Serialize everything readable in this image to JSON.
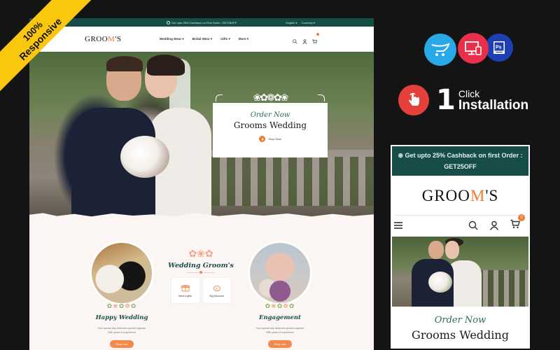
{
  "ribbon": {
    "line1": "100%",
    "line2": "Responsive"
  },
  "desktop": {
    "topbar": {
      "promo": "Get upto 25% Cashback on First Order : GET25OFF",
      "language": "English",
      "currency": "Currency"
    },
    "logo": {
      "prefix": "GROO",
      "accent": "M",
      "suffix": "'S"
    },
    "menu": [
      {
        "label": "Wedding Wear"
      },
      {
        "label": "Bridal Wear"
      },
      {
        "label": "Gifts"
      },
      {
        "label": "More"
      }
    ],
    "icons": [
      "search-icon",
      "user-icon",
      "cart-icon"
    ],
    "hero": {
      "script": "Order Now",
      "title": "Grooms Wedding",
      "button": "Shop Now"
    },
    "section": {
      "title": "Wedding Groom's",
      "features": [
        {
          "label": "Send a gifts",
          "icon": "gift-icon"
        },
        {
          "label": "Big Discount",
          "icon": "piggy-bank-icon"
        }
      ],
      "items": [
        {
          "title": "Happy Wedding",
          "desc1": "Your special day deserves special organize",
          "desc2": "With years of experience",
          "button": "Shop now"
        },
        {
          "title": "Engagement",
          "desc1": "Your special day deserves special organize",
          "desc2": "With years of experience",
          "button": "Shop now"
        }
      ]
    }
  },
  "platforms": [
    "opencart-icon",
    "responsive-devices-icon",
    "photoshop-icon"
  ],
  "platform_text": {
    "ps": "Ps"
  },
  "install": {
    "number": "1",
    "line1": "Click",
    "line2": "Installation"
  },
  "mobile": {
    "promo": "Get upto 25% Cashback on first Order : GET25OFF",
    "logo": {
      "prefix": "GROO",
      "accent": "M",
      "suffix": "'S"
    },
    "cart_count": "0",
    "script": "Order Now",
    "title": "Grooms Wedding"
  },
  "colors": {
    "brand_teal": "#174d49",
    "accent_orange": "#f07a33",
    "ribbon_yellow": "#f9c80e"
  }
}
